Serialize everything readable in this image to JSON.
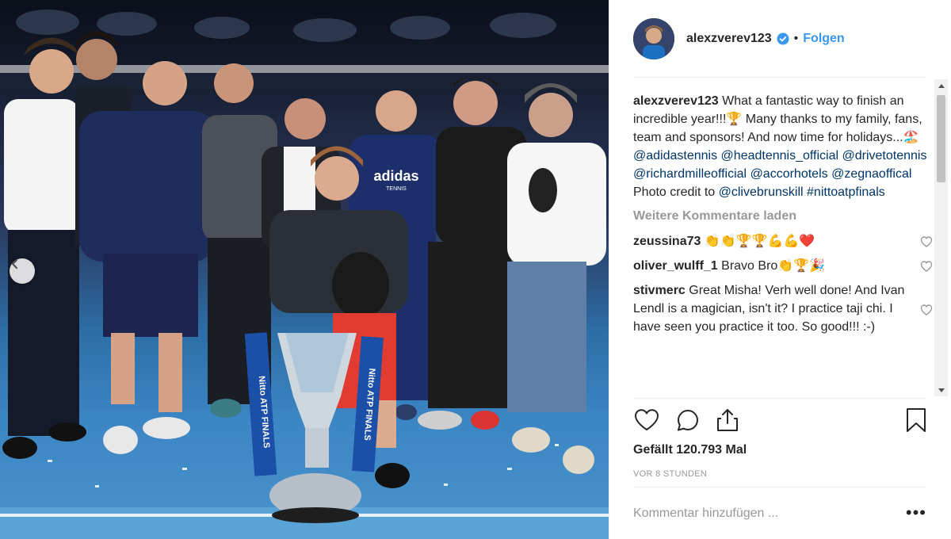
{
  "post": {
    "username": "alexzverev123",
    "follow_label": "Folgen",
    "separator": "•",
    "caption": {
      "username": "alexzverev123",
      "text": "What a fantastic way to finish an incredible year!!!🏆 Many thanks to my family, fans, team and sponsors! And now time for holidays...🏖️",
      "tags": [
        "@adidastennis",
        "@headtennis_official",
        "@drivetotennis",
        "@richardmilleofficial",
        "@accorhotels",
        "@zegnaoffical"
      ],
      "credit_text": "Photo credit to",
      "credit_tags": [
        "@clivebrunskill",
        "#nittoatpfinals"
      ]
    },
    "load_more_label": "Weitere Kommentare laden",
    "comments": [
      {
        "user": "zeussina73",
        "text": "👏👏🏆🏆💪💪❤️"
      },
      {
        "user": "oliver_wulff_1",
        "text": "Bravo Bro👏🏆🎉"
      },
      {
        "user": "stivmerc",
        "text": "Great Misha! Verh well done! And Ivan Lendl is a magician, isn't it? I practice taji chi. I have seen you practice it too. So good!!! :-)"
      }
    ],
    "likes_text": "Gefällt 120.793 Mal",
    "time_text": "VOR 8 STUNDEN",
    "comment_placeholder": "Kommentar hinzufügen ...",
    "more_label": "•••"
  },
  "photo": {
    "trophy_banner_text": "Nitto ATP FINALS",
    "shirt_brand": "adidas",
    "shirt_sub": "TENNIS"
  },
  "icons": {
    "verified": "verified-badge-icon",
    "like": "heart-outline-icon",
    "comment": "speech-bubble-icon",
    "share": "share-upload-icon",
    "save": "bookmark-icon",
    "prev": "chevron-left-icon"
  },
  "colors": {
    "link": "#003569",
    "follow": "#3897f0",
    "muted": "#999999",
    "divider": "#efefef"
  }
}
